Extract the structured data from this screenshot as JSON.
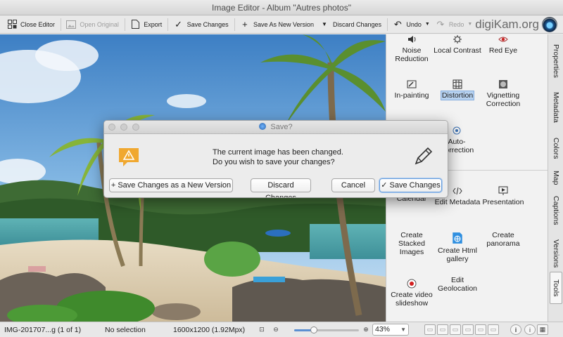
{
  "window": {
    "title": "Image Editor - Album \"Autres photos\""
  },
  "toolbar": {
    "close_editor": "Close Editor",
    "open_original": "Open Original",
    "export": "Export",
    "save_changes": "Save Changes",
    "save_as_new_version": "Save As New Version",
    "discard_changes": "Discard Changes",
    "undo": "Undo",
    "redo": "Redo",
    "brand": "digiKam.org"
  },
  "tools": {
    "noise_reduction": "Noise Reduction",
    "local_contrast": "Local Contrast",
    "red_eye": "Red Eye",
    "in_painting": "In-painting",
    "distortion": "Distortion",
    "vignetting_correction": "Vignetting Correction",
    "auto_correction": "Auto-Correction",
    "create_calendar": "Create Calendar",
    "edit_metadata": "Edit Metadata",
    "presentation": "Presentation",
    "create_stacked_images": "Create Stacked Images",
    "create_html_gallery": "Create Html gallery",
    "create_panorama": "Create panorama",
    "create_video_slideshow": "Create video slideshow",
    "edit_geolocation": "Edit Geolocation"
  },
  "side_tabs": {
    "properties": "Properties",
    "metadata": "Metadata",
    "colors": "Colors",
    "map": "Map",
    "captions": "Captions",
    "versions": "Versions",
    "tools": "Tools"
  },
  "status": {
    "file_name": "IMG-201707...g (1 of 1)",
    "selection": "No selection",
    "image_size": "1600x1200 (1.92Mpx)",
    "zoom": "43%",
    "zoom_slider_fraction": 0.3
  },
  "dialog": {
    "title": "Save?",
    "message_line1": "The current image has been changed.",
    "message_line2": "Do you wish to save your changes?",
    "btn_save_new_version": "Save Changes as a New Version",
    "btn_discard": "Discard Changes",
    "btn_cancel": "Cancel",
    "btn_save": "Save Changes"
  },
  "colors": {
    "accent": "#5b8fd1",
    "selection": "#b7d2f0",
    "warning": "#f0a830"
  }
}
